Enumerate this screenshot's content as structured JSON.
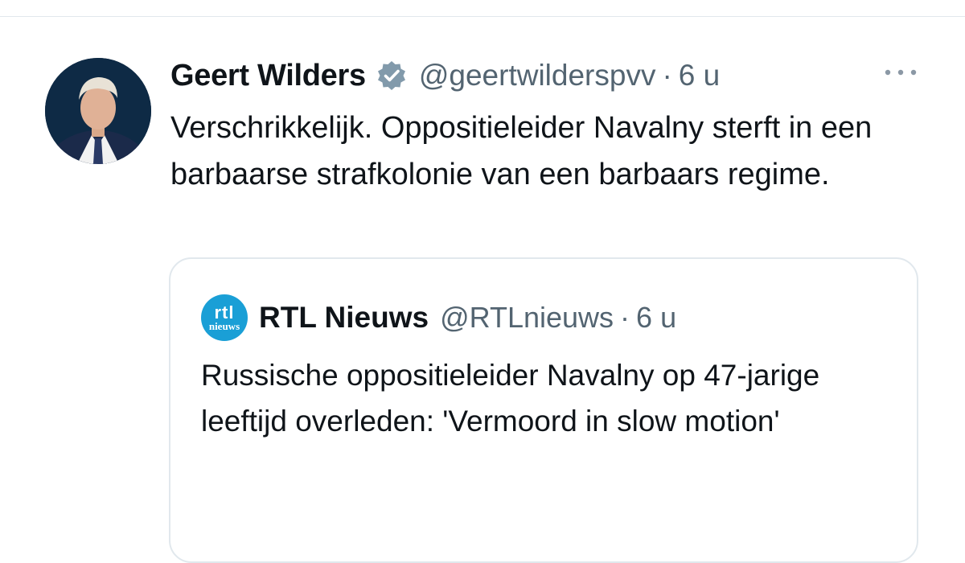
{
  "tweet": {
    "display_name": "Geert Wilders",
    "handle": "@geertwilderspvv",
    "separator": "·",
    "time": "6 u",
    "text": "Verschrikkelijk. Oppositieleider Navalny sterft in een barbaarse strafkolonie van een barbaars regime.",
    "verified_icon": "verified-badge",
    "more_icon": "ellipsis"
  },
  "quote": {
    "logo_top": "rtl",
    "logo_bottom": "nieuws",
    "display_name": "RTL Nieuws",
    "handle": "@RTLnieuws",
    "separator": "·",
    "time": "6 u",
    "text": "Russische oppositieleider Navalny op 47-jarige leeftijd overleden: 'Vermoord in slow motion'"
  },
  "colors": {
    "text": "#0f1419",
    "secondary": "#536471",
    "border": "#e1e8ed",
    "verified": "#829aab",
    "rtl_blue": "#1a9fd6"
  }
}
